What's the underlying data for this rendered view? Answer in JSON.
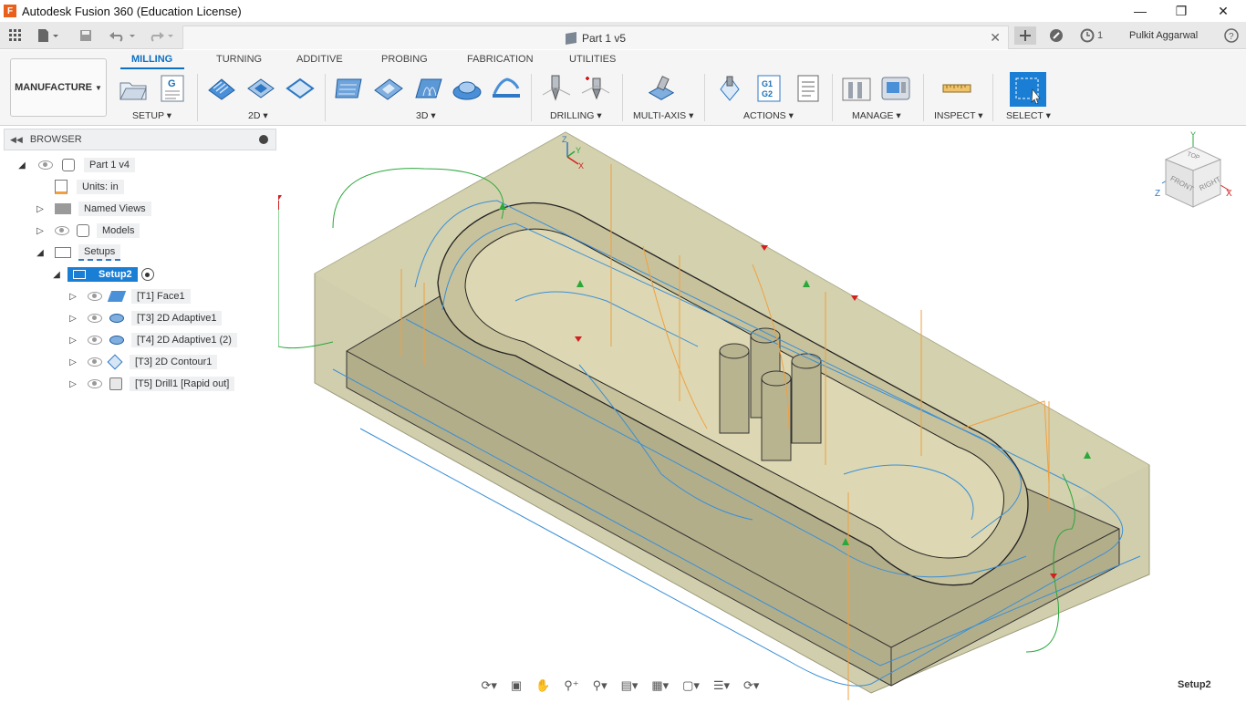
{
  "window": {
    "title": "Autodesk Fusion 360 (Education License)",
    "app_logo": "F"
  },
  "document_tab": {
    "title": "Part 1 v5"
  },
  "top_right": {
    "job_count": "1",
    "user_name": "Pulkit Aggarwal"
  },
  "workspace": {
    "label": "MANUFACTURE"
  },
  "tabs": [
    {
      "label": "MILLING"
    },
    {
      "label": "TURNING"
    },
    {
      "label": "ADDITIVE"
    },
    {
      "label": "PROBING"
    },
    {
      "label": "FABRICATION"
    },
    {
      "label": "UTILITIES"
    }
  ],
  "groups": {
    "setup": "SETUP",
    "two_d": "2D",
    "three_d": "3D",
    "drilling": "DRILLING",
    "multi_axis": "MULTI-AXIS",
    "actions": "ACTIONS",
    "manage": "MANAGE",
    "inspect": "INSPECT",
    "select": "SELECT"
  },
  "tool_glyphs": {
    "g_code": "G",
    "g1": "G1",
    "g2": "G2"
  },
  "browser": {
    "title": "BROWSER",
    "root": "Part 1 v4",
    "units": "Units: in",
    "named_views": "Named Views",
    "models": "Models",
    "setups": "Setups",
    "setup2": "Setup2",
    "operations": [
      "[T1] Face1",
      "[T3] 2D Adaptive1",
      "[T4] 2D Adaptive1 (2)",
      "[T3] 2D Contour1",
      "[T5] Drill1 [Rapid out]"
    ]
  },
  "viewcube": {
    "top": "TOP",
    "front": "FRONT",
    "right": "RIGHT",
    "z_axis": "Z",
    "x_axis": "X",
    "y_axis": "Y"
  },
  "triad": {
    "z": "Z",
    "y": "Y",
    "x": "X"
  },
  "status": {
    "active_setup": "Setup2"
  },
  "colors": {
    "accent": "#0b6fc3",
    "stock": "#c9c6a0",
    "toolpath_feed": "#3a8fd6",
    "toolpath_rapid": "#f0a040",
    "lead": "#2aa83a",
    "plunge_marker": "#d21f1f"
  }
}
